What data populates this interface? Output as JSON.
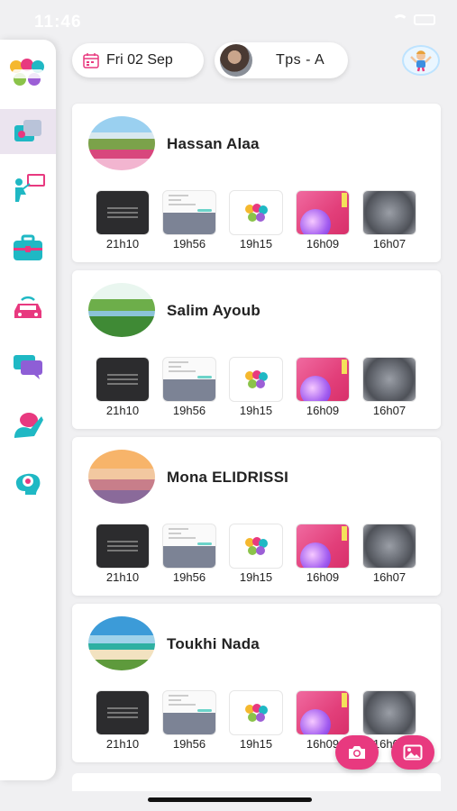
{
  "status_bar": {
    "time": "11:46"
  },
  "header": {
    "date_label": "Fri 02 Sep",
    "class_label": "Tps - A"
  },
  "sidebar": {
    "items": [
      {
        "icon": "logo-icon"
      },
      {
        "icon": "gallery-icon",
        "active": true
      },
      {
        "icon": "teacher-board-icon"
      },
      {
        "icon": "bag-icon"
      },
      {
        "icon": "car-icon"
      },
      {
        "icon": "chat-icon"
      },
      {
        "icon": "child-raise-hand-icon"
      },
      {
        "icon": "brain-icon"
      }
    ]
  },
  "students": [
    {
      "name": "Hassan Alaa",
      "avatar": "mountain-flowers",
      "photos": [
        {
          "time": "21h10",
          "type": "dark"
        },
        {
          "time": "19h56",
          "type": "form"
        },
        {
          "time": "19h15",
          "type": "logo"
        },
        {
          "time": "16h09",
          "type": "pink"
        },
        {
          "time": "16h07",
          "type": "stone"
        }
      ]
    },
    {
      "name": "Salim Ayoub",
      "avatar": "river",
      "photos": [
        {
          "time": "21h10",
          "type": "dark"
        },
        {
          "time": "19h56",
          "type": "form"
        },
        {
          "time": "19h15",
          "type": "logo"
        },
        {
          "time": "16h09",
          "type": "pink"
        },
        {
          "time": "16h07",
          "type": "stone"
        }
      ]
    },
    {
      "name": "Mona ELIDRISSI",
      "avatar": "sunset",
      "photos": [
        {
          "time": "21h10",
          "type": "dark"
        },
        {
          "time": "19h56",
          "type": "form"
        },
        {
          "time": "19h15",
          "type": "logo"
        },
        {
          "time": "16h09",
          "type": "pink"
        },
        {
          "time": "16h07",
          "type": "stone"
        }
      ]
    },
    {
      "name": "Toukhi Nada",
      "avatar": "beach",
      "photos": [
        {
          "time": "21h10",
          "type": "dark"
        },
        {
          "time": "19h56",
          "type": "form"
        },
        {
          "time": "19h15",
          "type": "logo"
        },
        {
          "time": "16h09",
          "type": "pink"
        },
        {
          "time": "16h07",
          "type": "stone"
        }
      ]
    }
  ],
  "colors": {
    "accent": "#e8397f",
    "teal": "#1fb8c4",
    "active_bg": "#ebe4ef"
  }
}
